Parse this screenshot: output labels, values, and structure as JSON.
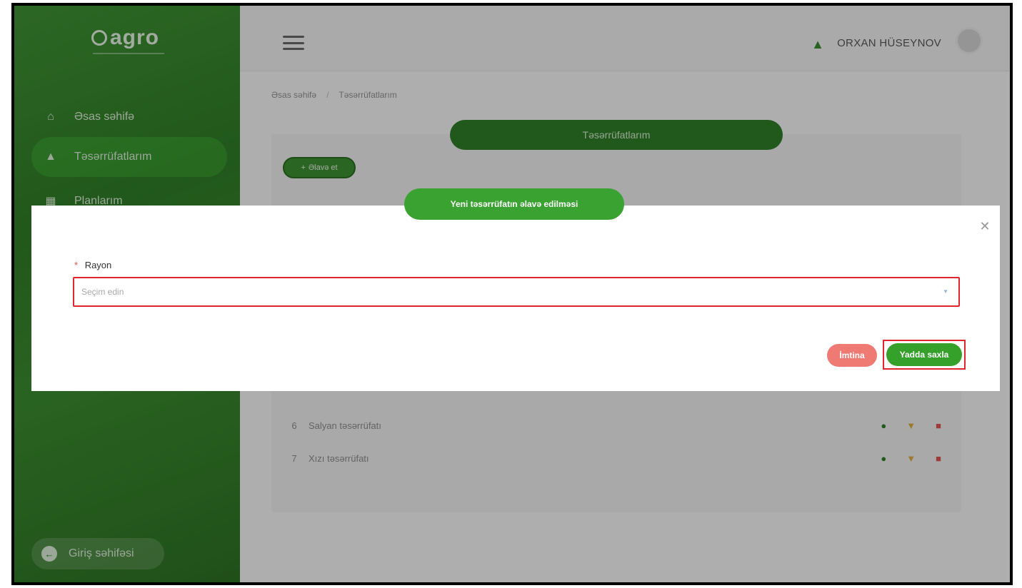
{
  "app": {
    "logo_text": "agro"
  },
  "sidebar": {
    "items": [
      {
        "label": "Əsas səhifə",
        "icon": "home-icon"
      },
      {
        "label": "Təsərrüfatlarım",
        "icon": "farmer-icon",
        "active": true
      },
      {
        "label": "Planlarım",
        "icon": "calendar-icon"
      }
    ],
    "login_label": "Giriş səhifəsi"
  },
  "header": {
    "user_name": "ORXAN HÜSEYNOV"
  },
  "breadcrumb": {
    "home": "Əsas səhifə",
    "current": "Təsərrüfatlarım"
  },
  "card": {
    "title": "Təsərrüfatlarım",
    "add_label": "Əlavə et"
  },
  "table": {
    "rows": [
      {
        "num": "6",
        "name": "Salyan təsərrüfatı"
      },
      {
        "num": "7",
        "name": "Xızı təsərrüfatı"
      }
    ]
  },
  "modal": {
    "title": "Yeni təsərrüfatın əlavə edilməsi",
    "field_label": "Rayon",
    "required_mark": "*",
    "select_placeholder": "Seçim edin",
    "cancel_label": "İmtina",
    "save_label": "Yadda saxla"
  },
  "colors": {
    "primary": "#35a02a",
    "danger": "#ef7a73",
    "highlight": "#e0252d",
    "sidebar": "#2f7a26"
  }
}
